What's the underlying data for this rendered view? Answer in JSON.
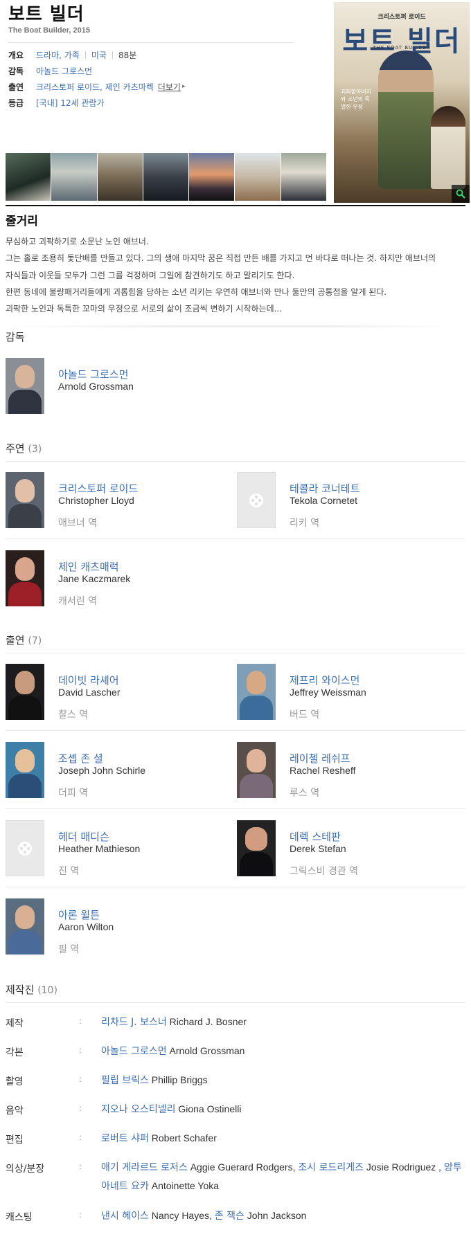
{
  "header": {
    "title": "보트 빌더",
    "subtitle": "The Boat Builder, 2015",
    "info": [
      {
        "key": "개요",
        "values": [
          "드라마, 가족",
          "미국",
          "88분"
        ]
      },
      {
        "key": "감독",
        "values": [
          "아놀드 그로스먼"
        ]
      },
      {
        "key": "출연",
        "values": [
          "크리스토퍼 로이드, 제인 카츠마렉"
        ],
        "more": "더보기"
      },
      {
        "key": "등급",
        "values": [
          "[국내] 12세 관람가"
        ]
      }
    ]
  },
  "poster": {
    "top_text": "크리스토퍼 로이드",
    "title": "보트 빌더",
    "en_title": "THE BOAT BUILDER",
    "tagline": "괴짜할아버지와 소년의 특별한 우정",
    "zoom_icon": "search-icon"
  },
  "synopsis": {
    "heading": "줄거리",
    "lines": [
      "무심하고 괴팍하기로 소문난 노인 애브너.",
      " 그는 홀로 조용히 돛단배를 만들고 있다. 그의 생애 마지막 꿈은 직접 만든 배를 가지고 먼 바다로 떠나는 것. 하지만 애브너의",
      "자식들과 이웃들 모두가 그런 그를 걱정하며 그일에 참견하기도 하고 말리기도 한다.",
      " 한편 동네에 불량패거리들에게 괴롭힘을 당하는 소년 리키는 우연히 애브너와 만나 둘만의 공통점을 알게 된다.",
      " 괴팍한 노인과 독특한 꼬마의 우정으로 서로의 삶이 조금씩 변하기 시작하는데..."
    ]
  },
  "director": {
    "heading": "감독",
    "person": {
      "ko": "아놀드 그로스먼",
      "en": "Arnold Grossman"
    }
  },
  "lead_cast": {
    "heading": "주연",
    "count": "(3)",
    "people": [
      {
        "ko": "크리스토퍼 로이드",
        "en": "Christopher Lloyd",
        "role": "애브너 역"
      },
      {
        "ko": "테콜라 코너테트",
        "en": "Tekola Cornetet",
        "role": "리키 역"
      },
      {
        "ko": "제인 캐츠매럭",
        "en": "Jane Kaczmarek",
        "role": "캐서린 역"
      }
    ]
  },
  "supporting_cast": {
    "heading": "출연",
    "count": "(7)",
    "people": [
      {
        "ko": "데이빗 라셰어",
        "en": "David Lascher",
        "role": "찰스 역"
      },
      {
        "ko": "제프리 와이스먼",
        "en": "Jeffrey Weissman",
        "role": "버드 역"
      },
      {
        "ko": "조셉 존 셜",
        "en": "Joseph John Schirle",
        "role": "더피 역"
      },
      {
        "ko": "레이첼 레쉬프",
        "en": "Rachel Resheff",
        "role": "루스 역"
      },
      {
        "ko": "헤더 매디슨",
        "en": "Heather Mathieson",
        "role": "진 역"
      },
      {
        "ko": "데렉 스테판",
        "en": "Derek Stefan",
        "role": "그릭스비 경관 역"
      },
      {
        "ko": "아론 윌튼",
        "en": "Aaron Wilton",
        "role": "필 역"
      }
    ]
  },
  "staff": {
    "heading": "제작진",
    "count": "(10)",
    "colon": ":",
    "rows": [
      {
        "key": "제작",
        "entries": [
          {
            "ko": "리차드 J. 보스너",
            "en": "Richard J. Bosner"
          }
        ]
      },
      {
        "key": "각본",
        "entries": [
          {
            "ko": "아놀드 그로스먼",
            "en": "Arnold Grossman"
          }
        ]
      },
      {
        "key": "촬영",
        "entries": [
          {
            "ko": "필립 브릭스",
            "en": "Phillip Briggs"
          }
        ]
      },
      {
        "key": "음악",
        "entries": [
          {
            "ko": "지오나 오스티넬리",
            "en": "Giona Ostinelli"
          }
        ]
      },
      {
        "key": "편집",
        "entries": [
          {
            "ko": "로버트 샤퍼",
            "en": "Robert Schafer"
          }
        ]
      },
      {
        "key": "의상/분장",
        "entries": [
          {
            "ko": "애기 게라르드 로저스",
            "en": "Aggie Guerard Rodgers"
          },
          {
            "ko": "조시 로드리게즈",
            "en": "Josie Rodriguez"
          },
          {
            "ko": "앙투아네트 요카",
            "en": "Antoinette Yoka"
          }
        ]
      },
      {
        "key": "캐스팅",
        "entries": [
          {
            "ko": "낸시 헤이스",
            "en": "Nancy Hayes"
          },
          {
            "ko": "존 잭슨",
            "en": "John Jackson"
          }
        ]
      }
    ]
  },
  "colors": {
    "link": "#3d6fb4",
    "muted": "#999999",
    "rule": "#111111"
  }
}
